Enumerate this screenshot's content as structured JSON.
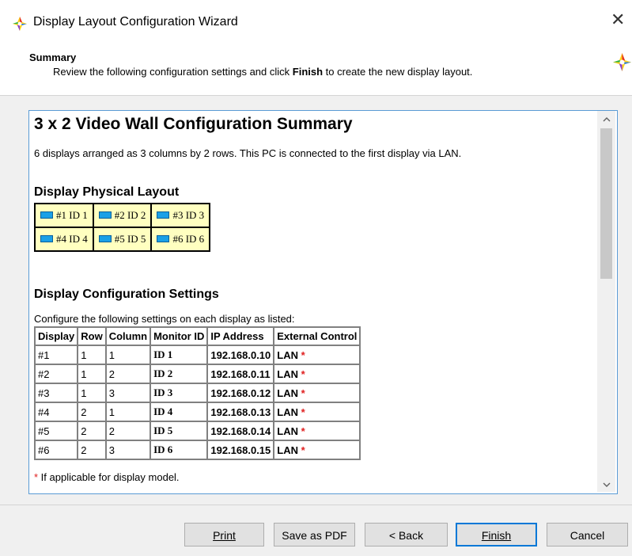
{
  "window": {
    "title": "Display Layout Configuration Wizard",
    "close_glyph": "✕"
  },
  "header": {
    "heading": "Summary",
    "description_pre": "Review the following configuration settings and click ",
    "description_bold": "Finish",
    "description_post": " to create the new display layout."
  },
  "report": {
    "title": "3 x 2 Video Wall Configuration Summary",
    "description": "6 displays arranged as 3 columns by 2 rows. This PC is connected to the first display via LAN.",
    "layout_heading": "Display Physical Layout",
    "layout_rows": [
      [
        "#1 ID 1",
        "#2 ID 2",
        "#3 ID 3"
      ],
      [
        "#4 ID 4",
        "#5 ID 5",
        "#6 ID 6"
      ]
    ],
    "config_heading": "Display Configuration Settings",
    "config_description": "Configure the following settings on each display as listed:",
    "columns": [
      "Display",
      "Row",
      "Column",
      "Monitor ID",
      "IP Address",
      "External Control"
    ],
    "rows": [
      {
        "display": "#1",
        "row": "1",
        "column": "1",
        "monitor_id": "ID 1",
        "ip": "192.168.0.10",
        "control": "LAN"
      },
      {
        "display": "#2",
        "row": "1",
        "column": "2",
        "monitor_id": "ID 2",
        "ip": "192.168.0.11",
        "control": "LAN"
      },
      {
        "display": "#3",
        "row": "1",
        "column": "3",
        "monitor_id": "ID 3",
        "ip": "192.168.0.12",
        "control": "LAN"
      },
      {
        "display": "#4",
        "row": "2",
        "column": "1",
        "monitor_id": "ID 4",
        "ip": "192.168.0.13",
        "control": "LAN"
      },
      {
        "display": "#5",
        "row": "2",
        "column": "2",
        "monitor_id": "ID 5",
        "ip": "192.168.0.14",
        "control": "LAN"
      },
      {
        "display": "#6",
        "row": "2",
        "column": "3",
        "monitor_id": "ID 6",
        "ip": "192.168.0.15",
        "control": "LAN"
      }
    ],
    "asterisk": "*",
    "footnote": " If applicable for display model."
  },
  "buttons": {
    "print": "Print",
    "save_pdf": "Save as PDF",
    "back": "< Back",
    "finish": "Finish",
    "cancel": "Cancel"
  },
  "colors": {
    "accent": "#0078d7",
    "layout_cell": "#ffffc0",
    "asterisk": "#e02020"
  },
  "icons": {
    "app": "color-wheel-icon",
    "header": "color-wheel-icon",
    "monitor": "monitor-icon"
  }
}
